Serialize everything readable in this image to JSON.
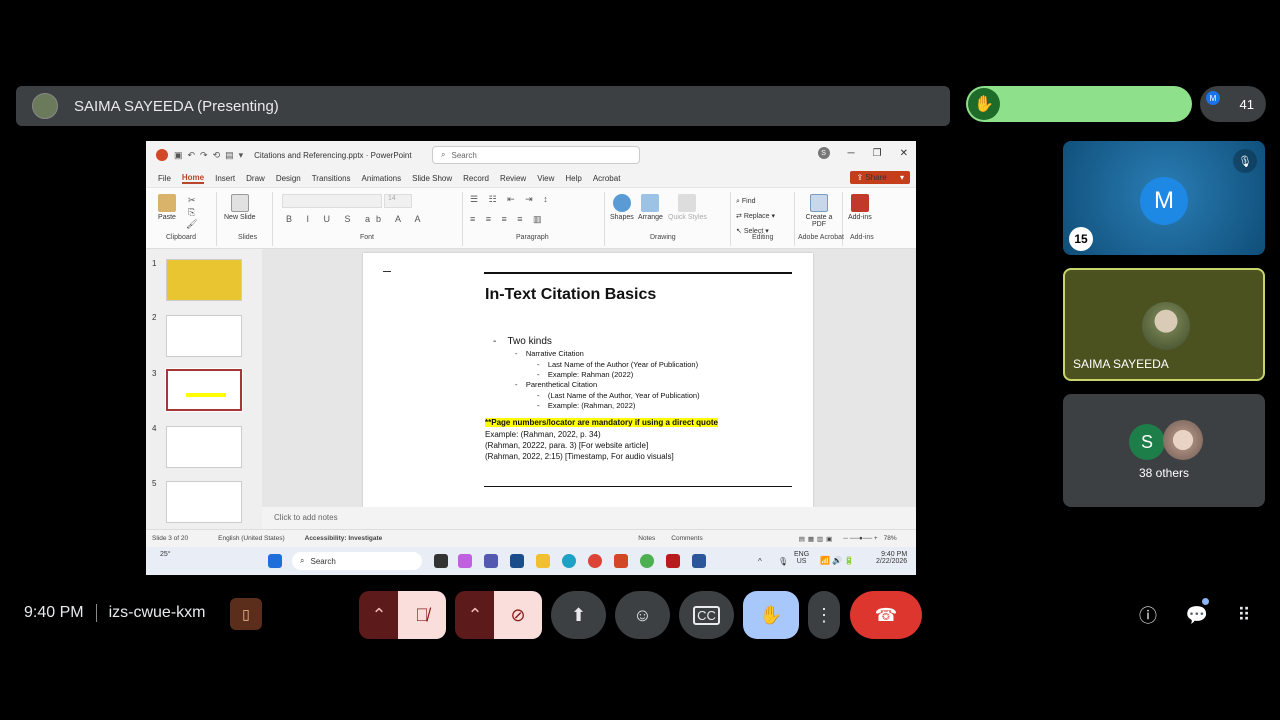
{
  "meeting": {
    "presenter_label": "SAIMA SAYEEDA (Presenting)",
    "participant_count": "41",
    "people_initial": "M",
    "time": "9:40 PM",
    "code": "izs-cwue-kxm"
  },
  "window": {
    "title": "Citations and Referencing.pptx  ·  PowerPoint",
    "search_placeholder": "Search",
    "user_initial": "S",
    "menu": [
      "File",
      "Home",
      "Insert",
      "Draw",
      "Design",
      "Transitions",
      "Animations",
      "Slide Show",
      "Record",
      "Review",
      "View",
      "Help",
      "Acrobat"
    ],
    "active_menu": "Home",
    "share_label": "Share",
    "ribbon": {
      "paste": "Paste",
      "new_slide": "New Slide",
      "shapes": "Shapes",
      "arrange": "Arrange",
      "quick_styles": "Quick Styles",
      "find": "Find",
      "replace": "Replace",
      "select": "Select",
      "create_pdf": "Create a PDF",
      "add_ins": "Add-ins",
      "font_size": "14",
      "groups": {
        "clipboard": "Clipboard",
        "slides": "Slides",
        "font": "Font",
        "paragraph": "Paragraph",
        "drawing": "Drawing",
        "editing": "Editing",
        "adobe": "Adobe Acrobat",
        "addins": "Add-ins"
      }
    },
    "thumbnails": [
      "1",
      "2",
      "3",
      "4",
      "5"
    ],
    "slide": {
      "title": "In-Text Citation Basics",
      "bullet_main": "Two kinds",
      "narrative": "Narrative Citation",
      "narrative_fmt": "Last Name of the Author (Year of Publication)",
      "narrative_ex": "Example: Rahman (2022)",
      "parenthetical": "Parenthetical Citation",
      "paren_fmt": "(Last Name of the Author, Year of Publication)",
      "paren_ex": "Example: (Rahman, 2022)",
      "note": "**Page numbers/locator are mandatory if using a direct quote",
      "ex1": "Example: (Rahman, 2022, p. 34)",
      "ex2": "(Rahman, 20222, para. 3) [For website article]",
      "ex3": "(Rahman, 2022, 2:15) [Timestamp, For audio visuals]"
    },
    "notes_placeholder": "Click to add notes",
    "status": {
      "slide_of": "Slide 3 of 20",
      "language": "English (United States)",
      "accessibility": "Accessibility: Investigate",
      "notes": "Notes",
      "comments": "Comments",
      "zoom": "78%"
    },
    "taskbar": {
      "temp": "25°",
      "search": "Search",
      "lang": "ENG",
      "region": "US",
      "time": "9:40 PM",
      "date": "2/22/2026"
    }
  },
  "tiles": {
    "tile1_initial": "M",
    "tile1_hand_badge": "15",
    "tile2_name": "SAIMA SAYEEDA",
    "tile3_initial": "S",
    "tile3_label": "38 others"
  }
}
